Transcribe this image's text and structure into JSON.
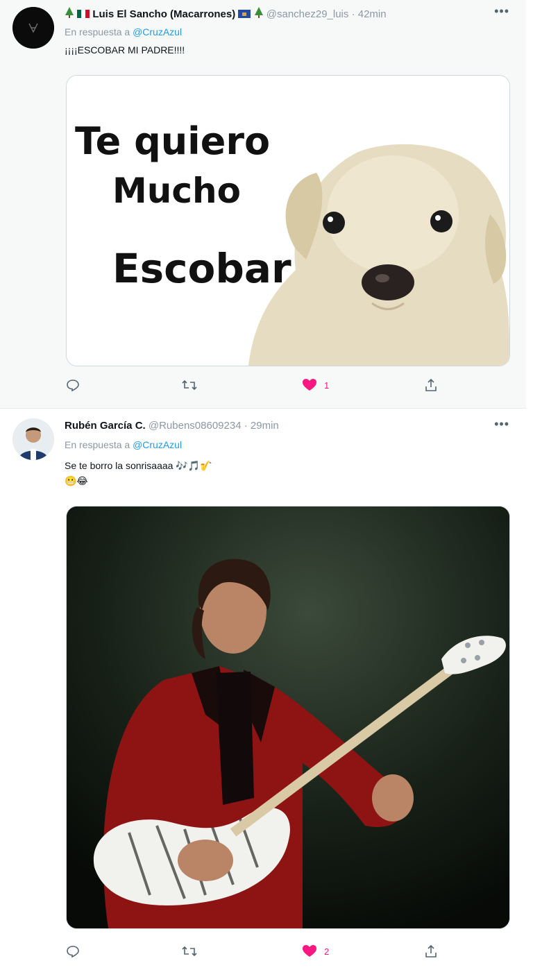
{
  "tweets": [
    {
      "name": "Luis El Sancho (Macarrones)",
      "handle": "@sanchez29_luis",
      "time": "42min",
      "reply_prefix": "En respuesta a",
      "reply_to": "@CruzAzul",
      "text": "¡¡¡¡ESCOBAR MI PADRE!!!!",
      "image_text": [
        "Te quiero",
        "Mucho",
        "Escobar"
      ],
      "likes": "1",
      "liked": true
    },
    {
      "name": "Rubén García C.",
      "handle": "@Rubens08609234",
      "time": "29min",
      "reply_prefix": "En respuesta a",
      "reply_to": "@CruzAzul",
      "text": "Se te borro la sonrisaaaa 🎶🎵🎷",
      "text2": "😬😂",
      "likes": "2",
      "liked": true
    }
  ],
  "colors": {
    "like": "#f91880",
    "mention": "#1d9bf0",
    "muted": "#8b98a5",
    "icon": "#536471"
  },
  "icons": [
    "reply-icon",
    "retweet-icon",
    "like-icon",
    "share-icon",
    "more-icon"
  ]
}
